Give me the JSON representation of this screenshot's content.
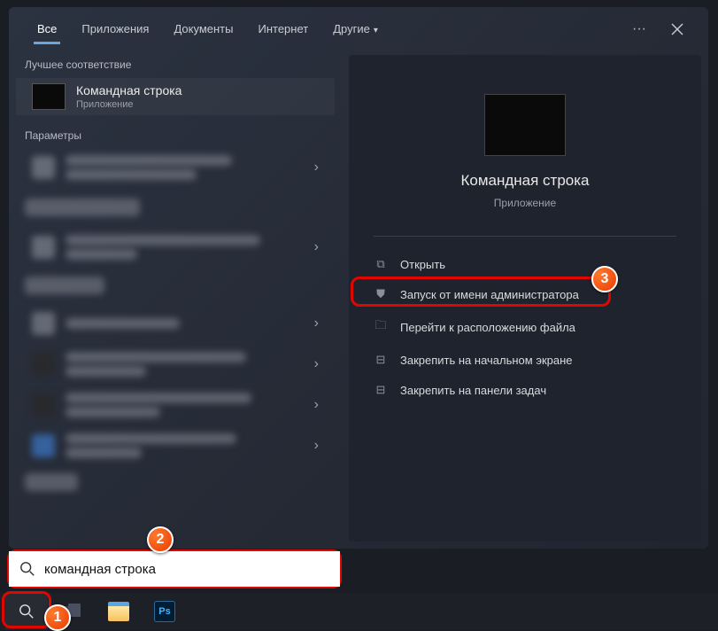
{
  "tabs": {
    "all": "Все",
    "apps": "Приложения",
    "docs": "Документы",
    "web": "Интернет",
    "more": "Другие"
  },
  "left": {
    "best_header": "Лучшее соответствие",
    "best_title": "Командная строка",
    "best_sub": "Приложение",
    "params_header": "Параметры"
  },
  "right": {
    "title": "Командная строка",
    "sub": "Приложение",
    "actions": {
      "open": "Открыть",
      "runas": "Запуск от имени администратора",
      "location": "Перейти к расположению файла",
      "pin_start": "Закрепить на начальном экране",
      "pin_task": "Закрепить на панели задач"
    }
  },
  "search": {
    "value": "командная строка"
  },
  "badges": {
    "b1": "1",
    "b2": "2",
    "b3": "3"
  },
  "taskbar": {
    "ps": "Ps"
  }
}
